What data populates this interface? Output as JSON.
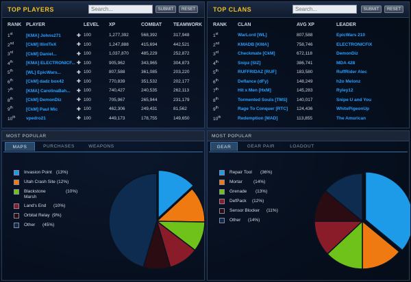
{
  "top_players": {
    "title": "TOP PLAYERS",
    "search_placeholder": "Search...",
    "submit_label": "SUBMIT",
    "reset_label": "RESET",
    "columns": [
      "RANK",
      "PLAYER",
      "LEVEL",
      "XP",
      "COMBAT",
      "TEAMWORK"
    ],
    "rows": [
      {
        "rank": "1",
        "suffix": "st",
        "player": "[KMA] Johns271",
        "level": "100",
        "xp": "1,277,392",
        "combat": "568,392",
        "teamwork": "317,948"
      },
      {
        "rank": "2",
        "suffix": "nd",
        "player": "[CkM] lllinlTeX",
        "level": "100",
        "xp": "1,247,888",
        "combat": "415,694",
        "teamwork": "442,521"
      },
      {
        "rank": "3",
        "suffix": "rd",
        "player": "[CkM] Daniel...",
        "level": "100",
        "xp": "1,037,870",
        "combat": "485,229",
        "teamwork": "252,872"
      },
      {
        "rank": "4",
        "suffix": "th",
        "player": "[KMA] ELECTRONICF...",
        "level": "100",
        "xp": "905,962",
        "combat": "343,965",
        "teamwork": "304,873"
      },
      {
        "rank": "5",
        "suffix": "th",
        "player": "[WL] EpicWars...",
        "level": "100",
        "xp": "807,588",
        "combat": "361,085",
        "teamwork": "203,220"
      },
      {
        "rank": "6",
        "suffix": "th",
        "player": "[CkM] dadz box42",
        "level": "100",
        "xp": "770,839",
        "combat": "351,532",
        "teamwork": "202,177"
      },
      {
        "rank": "7",
        "suffix": "th",
        "player": "[KMA] CarolinaBah...",
        "level": "100",
        "xp": "740,427",
        "combat": "240,535",
        "teamwork": "262,113"
      },
      {
        "rank": "8",
        "suffix": "th",
        "player": "[CkM] DemonDiz",
        "level": "100",
        "xp": "705,967",
        "combat": "265,944",
        "teamwork": "231,179"
      },
      {
        "rank": "9",
        "suffix": "th",
        "player": "[CkM] Paul Mic",
        "level": "100",
        "xp": "462,306",
        "combat": "249,431",
        "teamwork": "81,562"
      },
      {
        "rank": "10",
        "suffix": "th",
        "player": "vpedro21",
        "level": "100",
        "xp": "449,173",
        "combat": "178,755",
        "teamwork": "149,650"
      }
    ]
  },
  "top_clans": {
    "title": "TOP CLANS",
    "search_placeholder": "Search...",
    "submit_label": "SUBMIT",
    "reset_label": "RESET",
    "columns": [
      "RANK",
      "CLAN",
      "AVG XP",
      "LEADER"
    ],
    "rows": [
      {
        "rank": "1",
        "suffix": "st",
        "clan": "WarLord [WL]",
        "avg_xp": "807,588",
        "leader": "EpicWars 210"
      },
      {
        "rank": "2",
        "suffix": "nd",
        "clan": "KMADB [KMA]",
        "avg_xp": "758,746",
        "leader": "ELECTRONICFIX"
      },
      {
        "rank": "3",
        "suffix": "rd",
        "clan": "Checkmate [CkM]",
        "avg_xp": "672,118",
        "leader": "DemonDiz"
      },
      {
        "rank": "4",
        "suffix": "th",
        "clan": "Snipz [SIZ]",
        "avg_xp": "386,741",
        "leader": "MDA 428"
      },
      {
        "rank": "5",
        "suffix": "th",
        "clan": "RUFFRIDAZ [RUF]",
        "avg_xp": "183,580",
        "leader": "RuffRider Alec"
      },
      {
        "rank": "6",
        "suffix": "th",
        "clan": "Deflance (dFy)",
        "avg_xp": "148,249",
        "leader": "h2o Melonz"
      },
      {
        "rank": "7",
        "suffix": "th",
        "clan": "Hit x Men [HxM]",
        "avg_xp": "145,283",
        "leader": "Ryley12"
      },
      {
        "rank": "8",
        "suffix": "th",
        "clan": "Tormented Souls [TMS]",
        "avg_xp": "140,017",
        "leader": "Snipe U and You"
      },
      {
        "rank": "9",
        "suffix": "th",
        "clan": "Rage To Conquer [RTC]",
        "avg_xp": "124,436",
        "leader": "WhitePigeonUp"
      },
      {
        "rank": "10",
        "suffix": "th",
        "clan": "Redemption [MAD]",
        "avg_xp": "113,855",
        "leader": "The Amurican"
      }
    ]
  },
  "popular_maps": {
    "title": "MOST POPULAR",
    "tabs": [
      "MAPS",
      "PURCHASES",
      "WEAPONS"
    ],
    "active_tab": 0
  },
  "popular_gear": {
    "title": "MOST POPULAR",
    "tabs": [
      "GEAR",
      "GEAR PAIR",
      "LOADOUT"
    ],
    "active_tab": 0
  },
  "chart_data": [
    {
      "type": "pie",
      "categories": [
        "Invasion Point",
        "Utah Crash Site",
        "Blackstone Marsh",
        "Land's End",
        "Orbital Relay",
        "Other"
      ],
      "labels": [
        "Invasion Point",
        "Utah Crash Site",
        "Blackstone\nMarsh",
        "Land's End",
        "Orbital Relay",
        "Other"
      ],
      "pct_labels": [
        "(13%)",
        "(12%)",
        "(10%)",
        "(10%)",
        "(9%)",
        "(45%)"
      ],
      "values": [
        13,
        12,
        10,
        10,
        9,
        45
      ],
      "colors": [
        "#1e9be8",
        "#f07a12",
        "#6fc21a",
        "#8a1c2a",
        "#2a0c12",
        "#0e2c50"
      ]
    },
    {
      "type": "pie",
      "categories": [
        "Repair Tool",
        "Mortar",
        "Grenade",
        "DefPack",
        "Sensor Blocker",
        "Other"
      ],
      "labels": [
        "Repair Tool",
        "Mortar",
        "Grenade",
        "DefPack",
        "Sensor Blocker",
        "Other"
      ],
      "pct_labels": [
        "(36%)",
        "(14%)",
        "(13%)",
        "(12%)",
        "(11%)",
        "(14%)"
      ],
      "values": [
        36,
        14,
        13,
        12,
        11,
        14
      ],
      "colors": [
        "#1e9be8",
        "#f07a12",
        "#6fc21a",
        "#8a1c2a",
        "#2a0c12",
        "#0e2c50"
      ]
    }
  ]
}
